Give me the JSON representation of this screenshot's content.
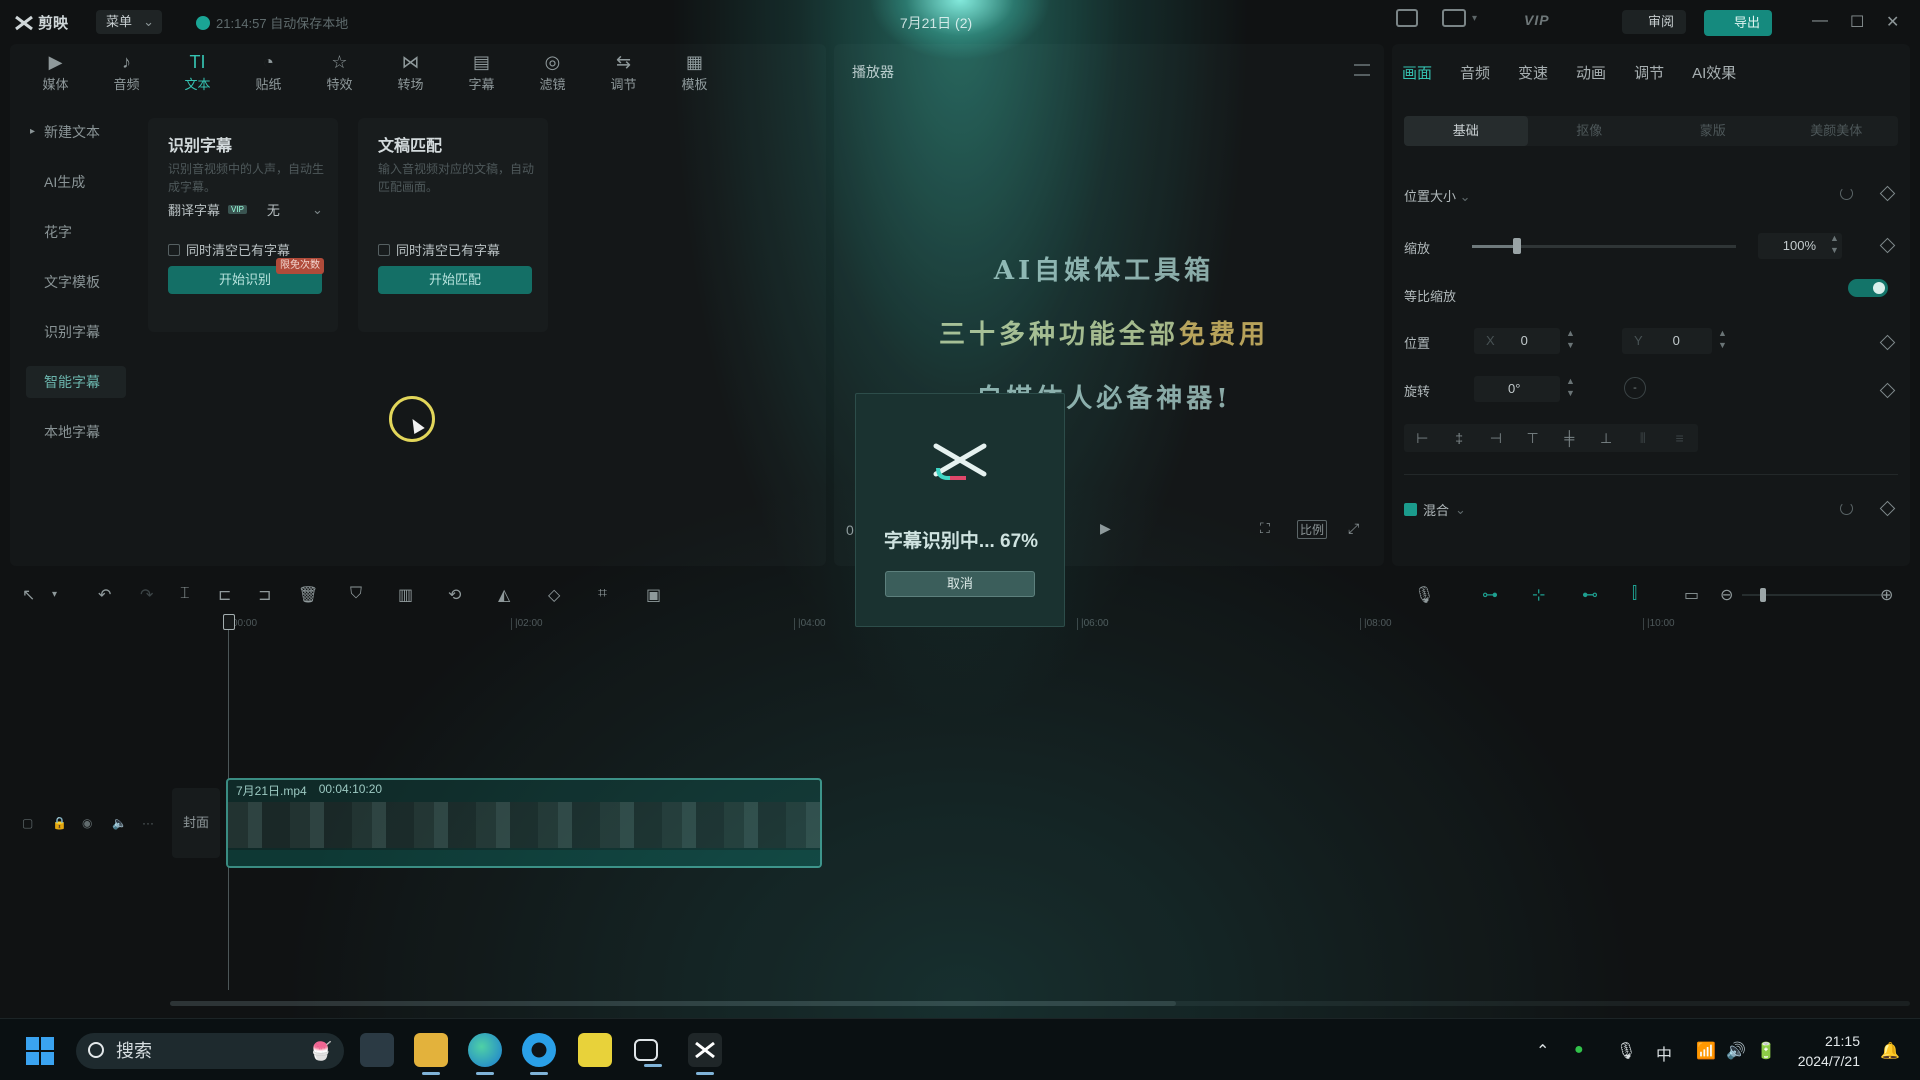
{
  "app": {
    "name": "剪映",
    "menu_label": "菜单",
    "autosave": "21:14:57 自动保存本地",
    "project_title": "7月21日 (2)",
    "vip": "VIP",
    "review_label": "审阅",
    "export_label": "导出"
  },
  "media_tabs": [
    {
      "label": "媒体",
      "icon": "media-icon"
    },
    {
      "label": "音频",
      "icon": "audio-icon"
    },
    {
      "label": "文本",
      "icon": "text-icon",
      "active": true
    },
    {
      "label": "贴纸",
      "icon": "sticker-icon"
    },
    {
      "label": "特效",
      "icon": "effects-icon"
    },
    {
      "label": "转场",
      "icon": "transition-icon"
    },
    {
      "label": "字幕",
      "icon": "subtitle-icon"
    },
    {
      "label": "滤镜",
      "icon": "filter-icon"
    },
    {
      "label": "调节",
      "icon": "adjust-icon"
    },
    {
      "label": "模板",
      "icon": "template-icon"
    }
  ],
  "side_menu": [
    "新建文本",
    "AI生成",
    "花字",
    "文字模板",
    "识别字幕",
    "智能字幕",
    "本地字幕"
  ],
  "cards": {
    "recognize": {
      "title": "识别字幕",
      "desc": "识别音视频中的人声，自动生成字幕。",
      "translate_label": "翻译字幕",
      "vip_tag": "VIP",
      "translate_value": "无",
      "clear_label": "同时清空已有字幕",
      "button": "开始识别",
      "badge": "限免次数"
    },
    "match": {
      "title": "文稿匹配",
      "desc": "输入音视频对应的文稿，自动匹配画面。",
      "clear_label": "同时清空已有字幕",
      "button": "开始匹配"
    }
  },
  "player": {
    "title": "播放器",
    "line1": "AI自媒体工具箱",
    "line2_a": "三十多种功能全部",
    "line2_b": "免费用",
    "line3": "自媒体人必备神器!",
    "time_start": "0",
    "ratio_label": "比例"
  },
  "props": {
    "tabs": [
      "画面",
      "音频",
      "变速",
      "动画",
      "调节",
      "AI效果"
    ],
    "subtabs": [
      "基础",
      "抠像",
      "蒙版",
      "美颜美体"
    ],
    "pos_size": "位置大小",
    "scale_label": "缩放",
    "scale_value": "100%",
    "scale_fraction": 0.17,
    "uniform_label": "等比缩放",
    "position_label": "位置",
    "x_label": "X",
    "x_value": "0",
    "y_label": "Y",
    "y_value": "0",
    "rotate_label": "旋转",
    "rotate_value": "0°",
    "rotate_dash": "-",
    "blend_label": "混合"
  },
  "timeline": {
    "ticks": [
      "00:00",
      "|02:00",
      "|04:00",
      "|06:00",
      "|08:00",
      "|10:00"
    ],
    "cover_label": "封面",
    "clip_name": "7月21日.mp4",
    "clip_duration": "00:04:10:20"
  },
  "modal": {
    "text": "字幕识别中... 67%",
    "progress": 0.67,
    "cancel": "取消"
  },
  "taskbar": {
    "search": "搜索",
    "ime": "中",
    "time": "21:15",
    "date": "2024/7/21"
  },
  "colors": {
    "accent": "#35c2b1",
    "export": "#158a7e",
    "card_button": "#146f66"
  }
}
